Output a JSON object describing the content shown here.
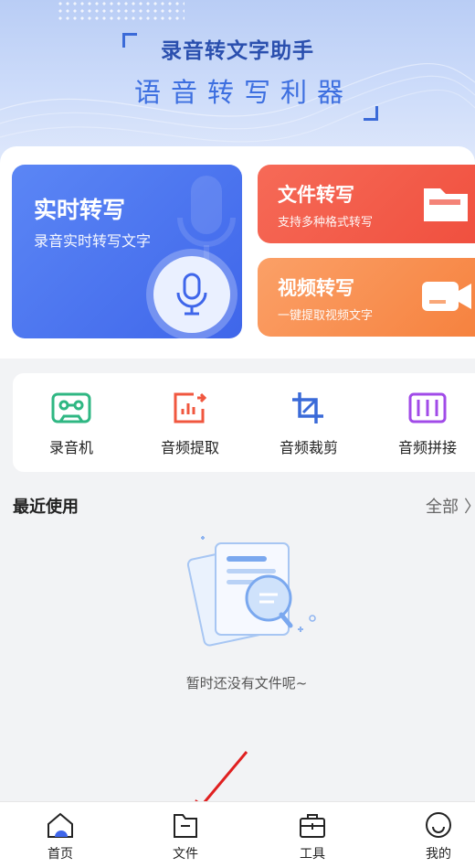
{
  "hero": {
    "title": "录音转文字助手",
    "subtitle": "语音转写利器"
  },
  "cards": {
    "realtime": {
      "title": "实时转写",
      "subtitle": "录音实时转写文字"
    },
    "file": {
      "title": "文件转写",
      "subtitle": "支持多种格式转写"
    },
    "video": {
      "title": "视频转写",
      "subtitle": "一键提取视频文字"
    }
  },
  "tools": [
    {
      "label": "录音机",
      "icon": "cassette-icon",
      "color": "#2fb783"
    },
    {
      "label": "音频提取",
      "icon": "audio-extract-icon",
      "color": "#f0573f"
    },
    {
      "label": "音频裁剪",
      "icon": "crop-icon",
      "color": "#3a6ad8"
    },
    {
      "label": "音频拼接",
      "icon": "audio-join-icon",
      "color": "#a14be8"
    }
  ],
  "recent": {
    "title": "最近使用",
    "all_label": "全部",
    "empty_text": "暂时还没有文件呢~"
  },
  "tabbar": [
    {
      "label": "首页",
      "icon": "home-icon"
    },
    {
      "label": "文件",
      "icon": "folder-icon"
    },
    {
      "label": "工具",
      "icon": "toolbox-icon"
    },
    {
      "label": "我的",
      "icon": "profile-smile-icon"
    }
  ],
  "colors": {
    "brand_blue": "#3f66ea",
    "file_red": "#f0503f",
    "video_orange": "#f6823f",
    "annotation_arrow": "#e02020"
  }
}
